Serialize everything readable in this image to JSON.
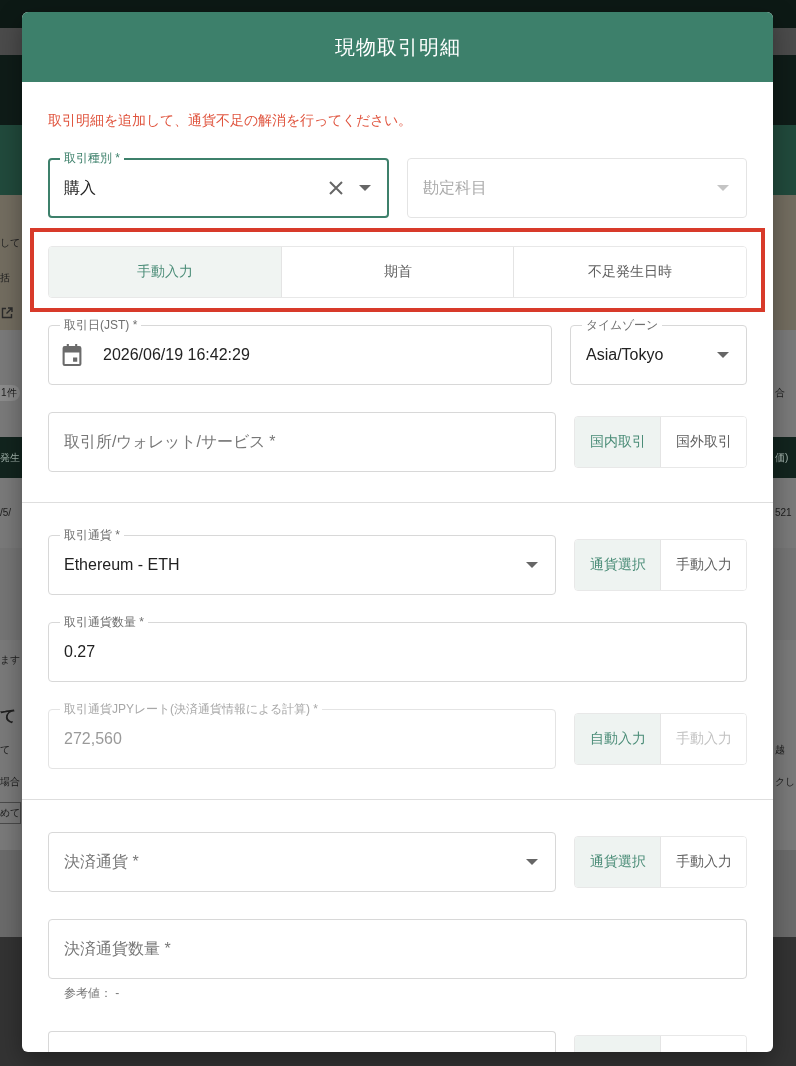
{
  "background": {
    "left": [
      {
        "kind": "text",
        "text": "して"
      },
      {
        "kind": "text",
        "text": "括"
      },
      {
        "kind": "pill",
        "text": "1件"
      },
      {
        "kind": "header",
        "text": "発生"
      },
      {
        "kind": "text",
        "text": "/5/"
      },
      {
        "kind": "text",
        "text": "ます"
      },
      {
        "kind": "heading",
        "text": "て"
      },
      {
        "kind": "text",
        "text": "て"
      },
      {
        "kind": "text",
        "text": "場合"
      },
      {
        "kind": "button",
        "text": "めて"
      }
    ],
    "right": [
      {
        "kind": "text",
        "text": "合"
      },
      {
        "kind": "header",
        "text": "価)"
      },
      {
        "kind": "text",
        "text": "521"
      },
      {
        "kind": "text",
        "text": "越"
      },
      {
        "kind": "text",
        "text": "クし"
      }
    ]
  },
  "dialog": {
    "title": "現物取引明細",
    "notice": "取引明細を追加して、通貨不足の解消を行ってください。",
    "sections": [
      {
        "rows": [
          {
            "kind": "pair",
            "items": [
              {
                "kind": "select",
                "label": "取引種別 *",
                "value": "購入",
                "focused": true,
                "disabled": false,
                "clearable": true
              },
              {
                "kind": "select",
                "placeholder": "勘定科目",
                "focused": false,
                "disabled": true,
                "clearable": false
              }
            ]
          },
          {
            "kind": "tabs",
            "highlighted": true,
            "items": [
              {
                "label": "手動入力",
                "selected": true
              },
              {
                "label": "期首",
                "selected": false
              },
              {
                "label": "不足発生日時",
                "selected": false
              }
            ]
          },
          {
            "kind": "main-side",
            "items": [
              {
                "kind": "date",
                "label": "取引日(JST) *",
                "value": "2026/06/19 16:42:29",
                "focused": false,
                "disabled": false
              },
              {
                "kind": "select",
                "label": "タイムゾーン",
                "value": "Asia/Tokyo",
                "focused": false,
                "disabled": false,
                "clearable": false
              }
            ]
          },
          {
            "kind": "main-side",
            "items": [
              {
                "kind": "text",
                "placeholder": "取引所/ウォレット/サービス *",
                "focused": false,
                "disabled": false
              },
              {
                "kind": "toggle",
                "options": [
                  {
                    "label": "国内取引",
                    "selected": true,
                    "disabled": false
                  },
                  {
                    "label": "国外取引",
                    "selected": false,
                    "disabled": false
                  }
                ]
              }
            ]
          }
        ]
      },
      {
        "rows": [
          {
            "kind": "main-side",
            "items": [
              {
                "kind": "select",
                "label": "取引通貨 *",
                "value": "Ethereum - ETH",
                "focused": false,
                "disabled": false,
                "clearable": false
              },
              {
                "kind": "toggle",
                "options": [
                  {
                    "label": "通貨選択",
                    "selected": true,
                    "disabled": false
                  },
                  {
                    "label": "手動入力",
                    "selected": false,
                    "disabled": false
                  }
                ]
              }
            ]
          },
          {
            "kind": "single",
            "items": [
              {
                "kind": "text",
                "label": "取引通貨数量 *",
                "value": "0.27",
                "focused": false,
                "disabled": false
              }
            ]
          },
          {
            "kind": "main-side",
            "items": [
              {
                "kind": "text",
                "label": "取引通貨JPYレート(決済通貨情報による計算) *",
                "value": "272,560",
                "focused": false,
                "disabled": true
              },
              {
                "kind": "toggle",
                "options": [
                  {
                    "label": "自動入力",
                    "selected": true,
                    "disabled": false
                  },
                  {
                    "label": "手動入力",
                    "selected": false,
                    "disabled": true
                  }
                ]
              }
            ]
          }
        ]
      },
      {
        "rows": [
          {
            "kind": "main-side",
            "items": [
              {
                "kind": "select",
                "placeholder": "決済通貨 *",
                "focused": false,
                "disabled": false,
                "clearable": false
              },
              {
                "kind": "toggle",
                "options": [
                  {
                    "label": "通貨選択",
                    "selected": true,
                    "disabled": false
                  },
                  {
                    "label": "手動入力",
                    "selected": false,
                    "disabled": false
                  }
                ]
              }
            ]
          },
          {
            "kind": "single",
            "items": [
              {
                "kind": "text",
                "placeholder": "決済通貨数量 *",
                "focused": false,
                "disabled": false
              }
            ]
          },
          {
            "kind": "helper",
            "text": "参考値： -"
          },
          {
            "kind": "clipped",
            "options": [
              {
                "selected": true
              },
              {
                "selected": false
              }
            ]
          }
        ]
      }
    ]
  }
}
